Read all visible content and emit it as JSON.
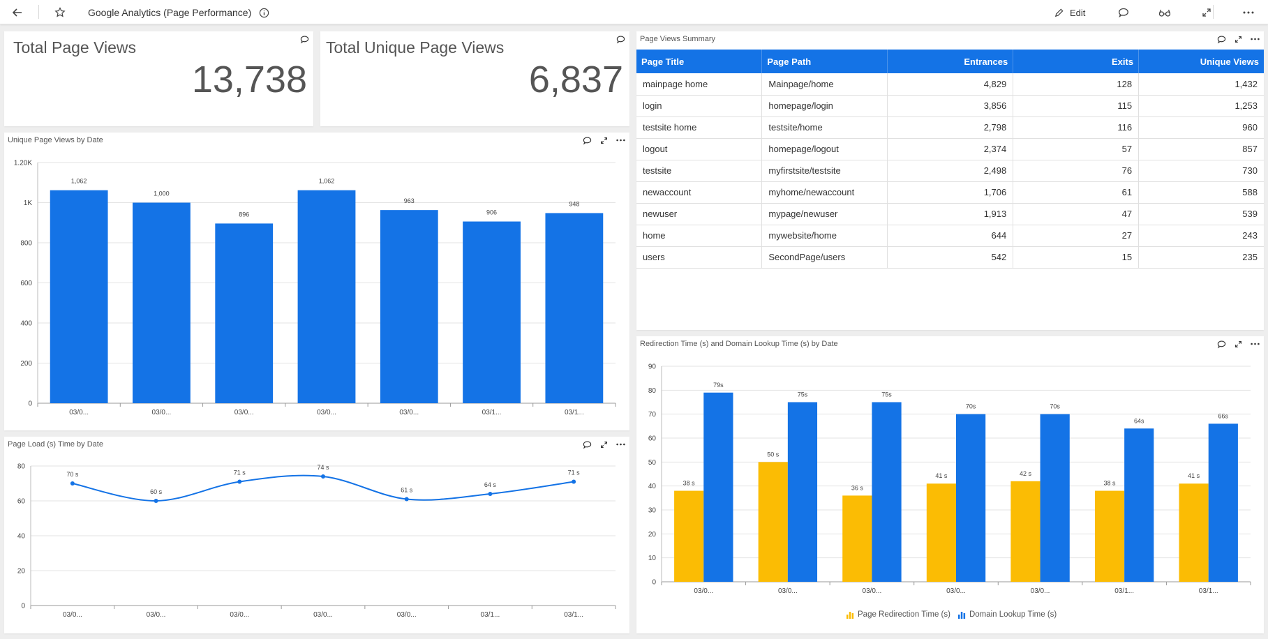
{
  "app": {
    "title": "Google Analytics (Page Performance)",
    "edit_label": "Edit",
    "colors": {
      "accent": "#1473e6",
      "secondary": "#fbbc04"
    }
  },
  "kpis": [
    {
      "label": "Total Page Views",
      "value": "13,738"
    },
    {
      "label": "Total Unique Page Views",
      "value": "6,837"
    }
  ],
  "summary": {
    "title": "Page Views Summary",
    "columns": [
      "Page Title",
      "Page Path",
      "Entrances",
      "Exits",
      "Unique Views"
    ],
    "rows": [
      [
        "mainpage home",
        "Mainpage/home",
        "4,829",
        "128",
        "1,432"
      ],
      [
        "login",
        "homepage/login",
        "3,856",
        "115",
        "1,253"
      ],
      [
        "testsite home",
        "testsite/home",
        "2,798",
        "116",
        "960"
      ],
      [
        "logout",
        "homepage/logout",
        "2,374",
        "57",
        "857"
      ],
      [
        "testsite",
        "myfirstsite/testsite",
        "2,498",
        "76",
        "730"
      ],
      [
        "newaccount",
        "myhome/newaccount",
        "1,706",
        "61",
        "588"
      ],
      [
        "newuser",
        "mypage/newuser",
        "1,913",
        "47",
        "539"
      ],
      [
        "home",
        "mywebsite/home",
        "644",
        "27",
        "243"
      ],
      [
        "users",
        "SecondPage/users",
        "542",
        "15",
        "235"
      ]
    ]
  },
  "chart_data": [
    {
      "type": "bar",
      "title": "Unique Page Views by Date",
      "categories": [
        "03/0...",
        "03/0...",
        "03/0...",
        "03/0...",
        "03/0...",
        "03/1...",
        "03/1..."
      ],
      "values": [
        1062,
        1000,
        896,
        1062,
        963,
        906,
        948
      ],
      "value_labels": [
        "1,062",
        "1,000",
        "896",
        "1,062",
        "963",
        "906",
        "948"
      ],
      "ylim": [
        0,
        1200
      ],
      "yticks": [
        0,
        200,
        400,
        600,
        800,
        1000,
        1200
      ],
      "ytick_labels": [
        "0",
        "200",
        "400",
        "600",
        "800",
        "1K",
        "1.20K"
      ],
      "grid": true
    },
    {
      "type": "line",
      "title": "Page Load (s) Time by Date",
      "categories": [
        "03/0...",
        "03/0...",
        "03/0...",
        "03/0...",
        "03/0...",
        "03/1...",
        "03/1..."
      ],
      "values": [
        70,
        60,
        71,
        74,
        61,
        64,
        71
      ],
      "value_labels": [
        "70 s",
        "60 s",
        "71 s",
        "74 s",
        "61 s",
        "64 s",
        "71 s"
      ],
      "ylim": [
        0,
        80
      ],
      "yticks": [
        0,
        20,
        40,
        60,
        80
      ],
      "ytick_labels": [
        "0",
        "20",
        "40",
        "60",
        "80"
      ],
      "grid": true
    },
    {
      "type": "bar",
      "title": "Redirection Time (s) and Domain Lookup Time (s) by Date",
      "categories": [
        "03/0...",
        "03/0...",
        "03/0...",
        "03/0...",
        "03/0...",
        "03/1...",
        "03/1..."
      ],
      "series": [
        {
          "name": "Page Redirection Time (s)",
          "color": "#fbbc04",
          "values": [
            38,
            50,
            36,
            41,
            42,
            38,
            41
          ],
          "labels": [
            "38 s",
            "50 s",
            "36 s",
            "41 s",
            "42 s",
            "38 s",
            "41 s"
          ]
        },
        {
          "name": "Domain Lookup Time (s)",
          "color": "#1473e6",
          "values": [
            79,
            75,
            75,
            70,
            70,
            64,
            66
          ],
          "labels": [
            "79s",
            "75s",
            "75s",
            "70s",
            "70s",
            "64s",
            "66s"
          ]
        }
      ],
      "ylim": [
        0,
        90
      ],
      "yticks": [
        0,
        10,
        20,
        30,
        40,
        50,
        60,
        70,
        80,
        90
      ],
      "ytick_labels": [
        "0",
        "10",
        "20",
        "30",
        "40",
        "50",
        "60",
        "70",
        "80",
        "90"
      ],
      "legend": "bottom",
      "grid": true
    }
  ]
}
